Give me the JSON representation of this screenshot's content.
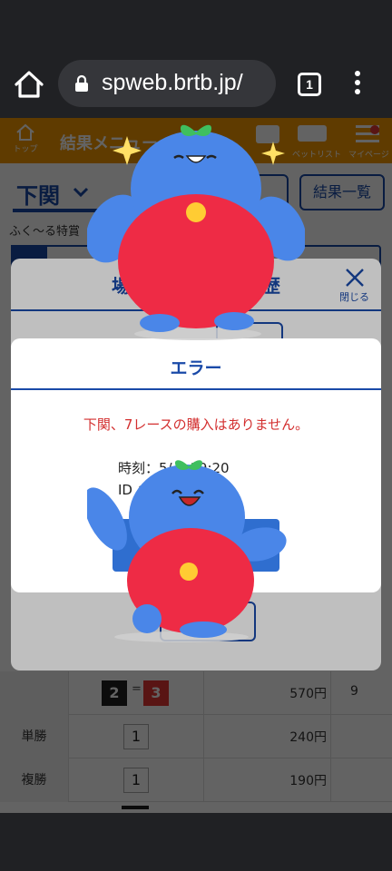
{
  "browser": {
    "url": "spweb.brtb.jp/",
    "tab_count": "1"
  },
  "navbar": {
    "home_label": "トップ",
    "title": "結果メニュー",
    "betlist_label": "ベットリスト",
    "mypage_label": "マイページ"
  },
  "page": {
    "venue": "下関",
    "button_results_list": "結果一覧",
    "button_partial": "歴",
    "subtitle": "ふく～る特賞"
  },
  "history_modal": {
    "title_left": "場",
    "title_right": "履歴",
    "close_label": "閉じる"
  },
  "error_modal": {
    "title": "エラー",
    "message": "下関、7レースの購入はありません。",
    "time_text": "時刻：5/　 19:20",
    "id_text": "ID ：0　　　 7"
  },
  "results": {
    "rows": [
      {
        "label": "",
        "boats": [
          "2",
          "3"
        ],
        "separator": "=",
        "payout": "570円",
        "popularity": "9"
      },
      {
        "label": "単勝",
        "num": "1",
        "payout": "240円",
        "popularity": ""
      },
      {
        "label": "複勝",
        "num": "1",
        "payout": "190円",
        "popularity": ""
      }
    ]
  },
  "colors": {
    "accent_blue": "#1a4aa8",
    "nav_orange": "#f39800",
    "error_red": "#d32f2f",
    "mascot_blue": "#4a86e8",
    "mascot_red": "#ee2b45"
  }
}
